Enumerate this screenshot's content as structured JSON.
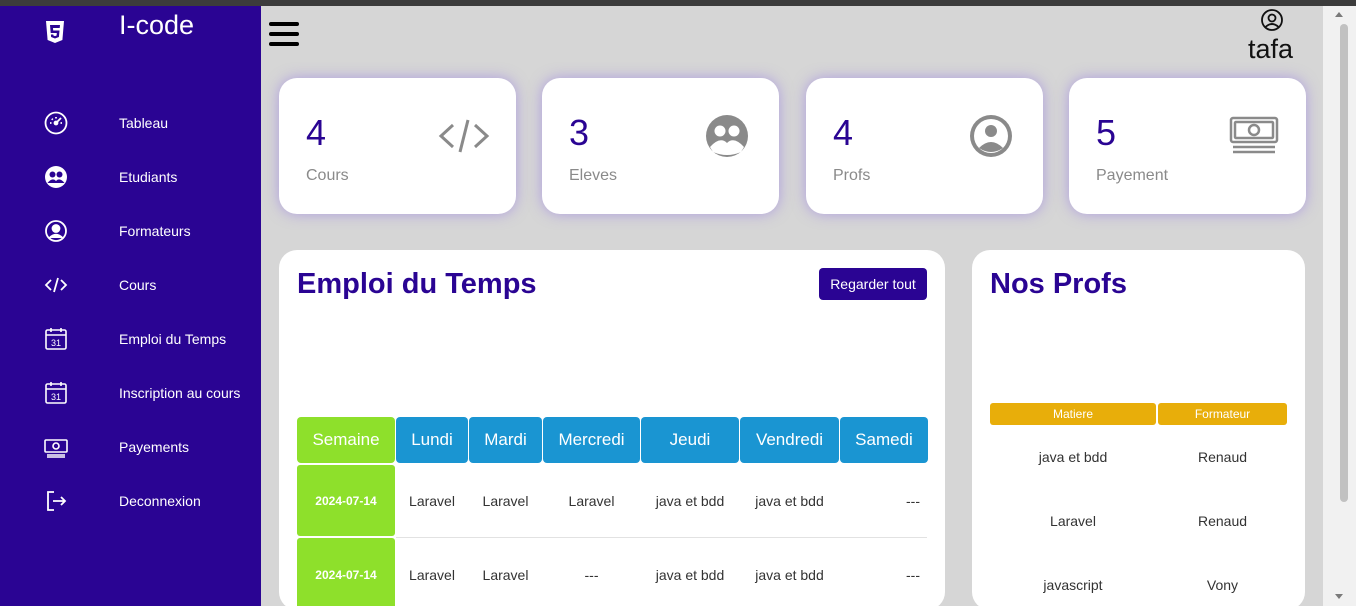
{
  "sidebar": {
    "brand": "I-code",
    "logo_icon": "html5-icon",
    "items": [
      {
        "label": "Tableau",
        "icon": "gauge-icon"
      },
      {
        "label": "Etudiants",
        "icon": "users-icon"
      },
      {
        "label": "Formateurs",
        "icon": "user-circle-icon"
      },
      {
        "label": "Cours",
        "icon": "code-icon"
      },
      {
        "label": "Emploi du Temps",
        "icon": "calendar-icon"
      },
      {
        "label": "Inscription au cours",
        "icon": "calendar-icon"
      },
      {
        "label": "Payements",
        "icon": "money-icon"
      },
      {
        "label": "Deconnexion",
        "icon": "logout-icon"
      }
    ]
  },
  "header": {
    "menu_icon": "hamburger-icon",
    "user_icon": "user-circle-icon",
    "username": "tafa"
  },
  "cards": [
    {
      "value": "4",
      "label": "Cours",
      "icon": "code-icon"
    },
    {
      "value": "3",
      "label": "Eleves",
      "icon": "users-icon"
    },
    {
      "value": "4",
      "label": "Profs",
      "icon": "user-circle-icon"
    },
    {
      "value": "5",
      "label": "Payement",
      "icon": "money-icon"
    }
  ],
  "schedule": {
    "title": "Emploi du Temps",
    "view_all": "Regarder tout",
    "headers": [
      "Semaine",
      "Lundi",
      "Mardi",
      "Mercredi",
      "Jeudi",
      "Vendredi",
      "Samedi"
    ],
    "rows": [
      {
        "week": "2024-07-14",
        "cells": [
          "Laravel",
          "Laravel",
          "Laravel",
          "java et bdd",
          "java et bdd",
          "---"
        ]
      },
      {
        "week": "2024-07-14",
        "cells": [
          "Laravel",
          "Laravel",
          "---",
          "java et bdd",
          "java et bdd",
          "---"
        ]
      }
    ]
  },
  "profs": {
    "title": "Nos Profs",
    "headers": [
      "Matiere",
      "Formateur"
    ],
    "rows": [
      {
        "matiere": "java et bdd",
        "formateur": "Renaud"
      },
      {
        "matiere": "Laravel",
        "formateur": "Renaud"
      },
      {
        "matiere": "javascript",
        "formateur": "Vony"
      }
    ]
  },
  "colors": {
    "sidebar": "#2a0493",
    "accent": "#2a0493",
    "day_header": "#1a95d2",
    "week_cell": "#8ee02b",
    "prof_header": "#e8ae0a"
  }
}
